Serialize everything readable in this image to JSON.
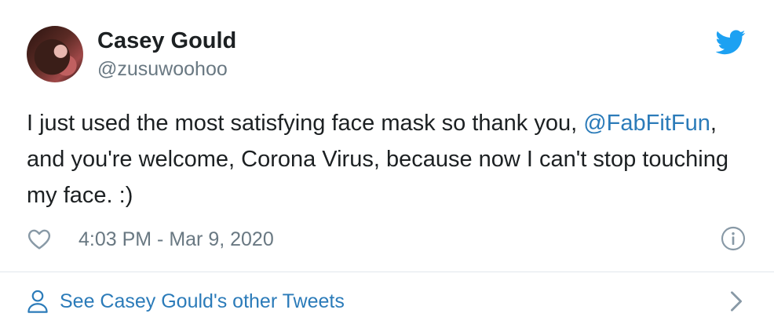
{
  "user": {
    "display_name": "Casey Gould",
    "handle": "@zusuwoohoo",
    "avatar_icon": "user-avatar-photo"
  },
  "brand": {
    "logo_icon": "twitter-bird-icon",
    "color": "#1da1f2"
  },
  "tweet": {
    "text_part1": "I just used the most satisfying face mask so thank you, ",
    "mention": "@FabFitFun",
    "text_part2": ", and you're welcome, Corona Virus, because now I can't stop touching my face. :)",
    "timestamp": "4:03 PM - Mar 9, 2020"
  },
  "actions": {
    "like_icon": "heart-icon",
    "info_icon": "info-icon"
  },
  "footer": {
    "link_label": "See Casey Gould's other Tweets",
    "person_icon": "person-icon",
    "chevron_icon": "chevron-right-icon"
  },
  "colors": {
    "text": "#1c2022",
    "secondary": "#697882",
    "link": "#2b7bb9",
    "divider": "#e1e8ed"
  }
}
